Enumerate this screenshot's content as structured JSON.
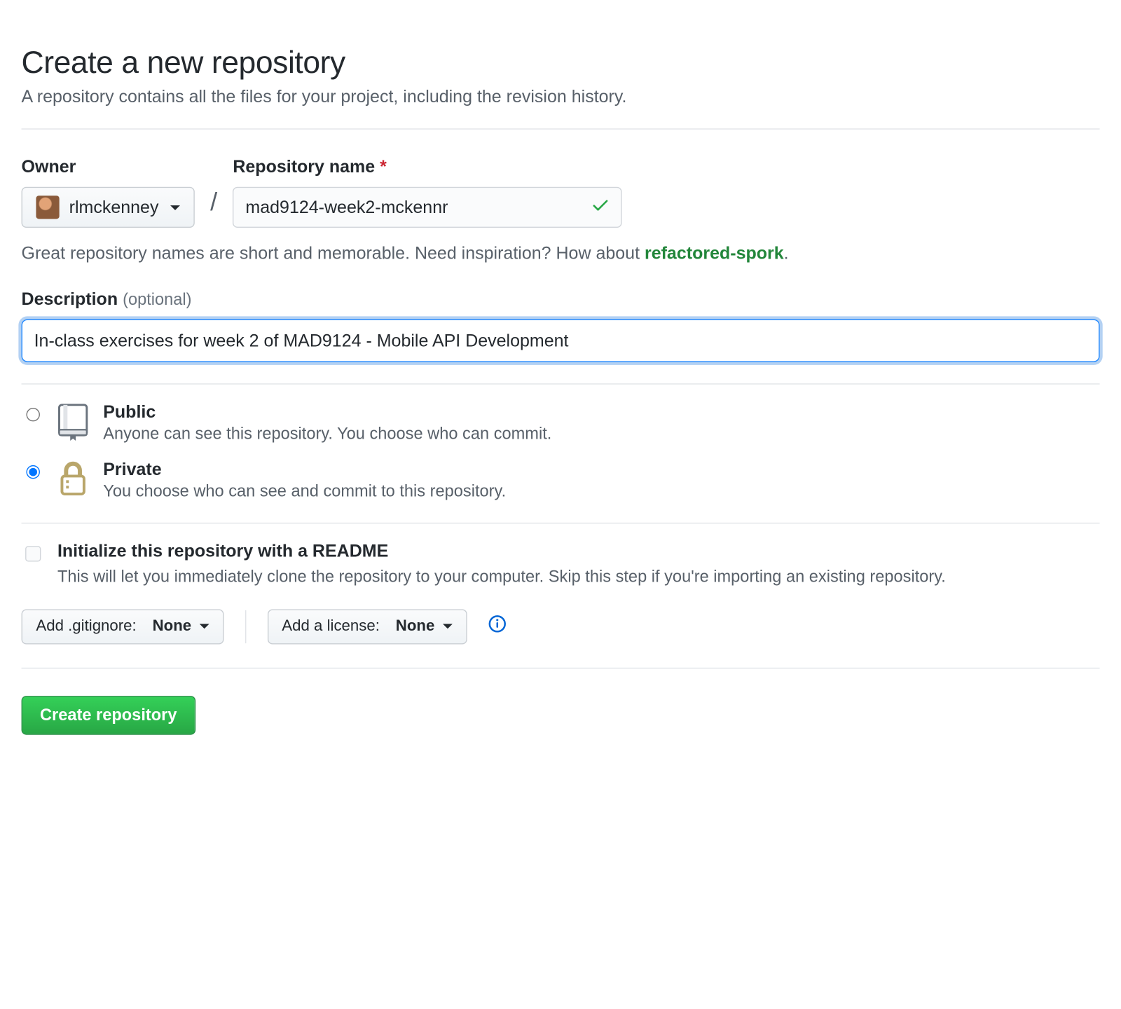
{
  "header": {
    "title": "Create a new repository",
    "subtitle": "A repository contains all the files for your project, including the revision history."
  },
  "owner": {
    "label": "Owner",
    "selected": "rlmckenney"
  },
  "repo": {
    "label": "Repository name",
    "required_mark": "*",
    "value": "mad9124-week2-mckennr"
  },
  "name_hint": {
    "prefix": "Great repository names are short and memorable. Need inspiration? How about ",
    "suggestion": "refactored-spork",
    "suffix": "."
  },
  "description": {
    "label": "Description",
    "optional_label": "(optional)",
    "value": "In-class exercises for week 2 of MAD9124 - Mobile API Development"
  },
  "visibility": {
    "public": {
      "title": "Public",
      "desc": "Anyone can see this repository. You choose who can commit."
    },
    "private": {
      "title": "Private",
      "desc": "You choose who can see and commit to this repository."
    }
  },
  "init": {
    "title": "Initialize this repository with a README",
    "desc": "This will let you immediately clone the repository to your computer. Skip this step if you're importing an existing repository."
  },
  "gitignore": {
    "label": "Add .gitignore:",
    "value": "None"
  },
  "license": {
    "label": "Add a license:",
    "value": "None"
  },
  "submit": {
    "label": "Create repository"
  }
}
